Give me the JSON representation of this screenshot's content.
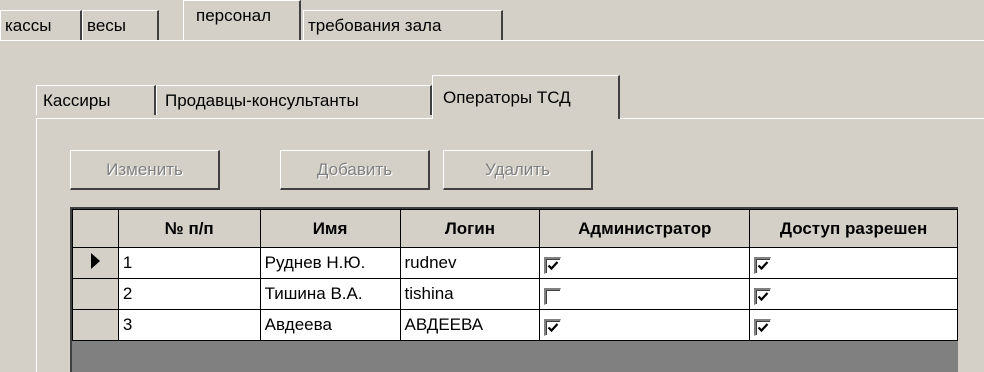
{
  "outer_tabs": [
    {
      "label": "кассы",
      "active": false
    },
    {
      "label": "весы",
      "active": false
    },
    {
      "label": "персонал",
      "active": true
    },
    {
      "label": "требования зала",
      "active": false
    }
  ],
  "inner_tabs": [
    {
      "label": "Кассиры",
      "active": false
    },
    {
      "label": "Продавцы-консультанты",
      "active": false
    },
    {
      "label": "Операторы ТСД",
      "active": true
    }
  ],
  "toolbar": {
    "edit_label": "Изменить",
    "add_label": "Добавить",
    "delete_label": "Удалить"
  },
  "grid": {
    "columns": [
      "№ п/п",
      "Имя",
      "Логин",
      "Администратор",
      "Доступ разрешен"
    ],
    "rows": [
      {
        "num": "1",
        "name": "Руднев Н.Ю.",
        "login": "rudnev",
        "admin": true,
        "access": true,
        "current": true
      },
      {
        "num": "2",
        "name": "Тишина В.А.",
        "login": "tishina",
        "admin": false,
        "access": true,
        "current": false
      },
      {
        "num": "3",
        "name": "Авдеева",
        "login": "АВДЕЕВА",
        "admin": true,
        "access": true,
        "current": false
      }
    ]
  }
}
